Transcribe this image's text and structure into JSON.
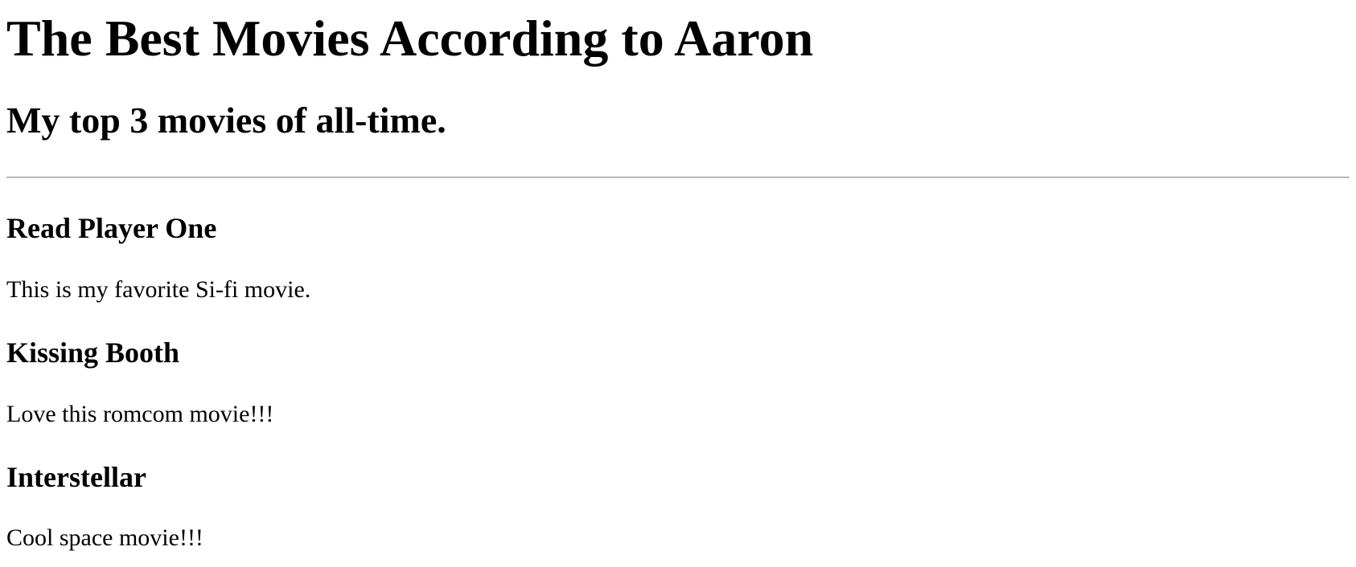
{
  "header": {
    "title": "The Best Movies According to Aaron",
    "subtitle": "My top 3 movies of all-time."
  },
  "movies": [
    {
      "title": "Read Player One",
      "description": "This is my favorite Si-fi movie."
    },
    {
      "title": "Kissing Booth",
      "description": "Love this romcom movie!!!"
    },
    {
      "title": "Interstellar",
      "description": "Cool space movie!!!"
    }
  ]
}
